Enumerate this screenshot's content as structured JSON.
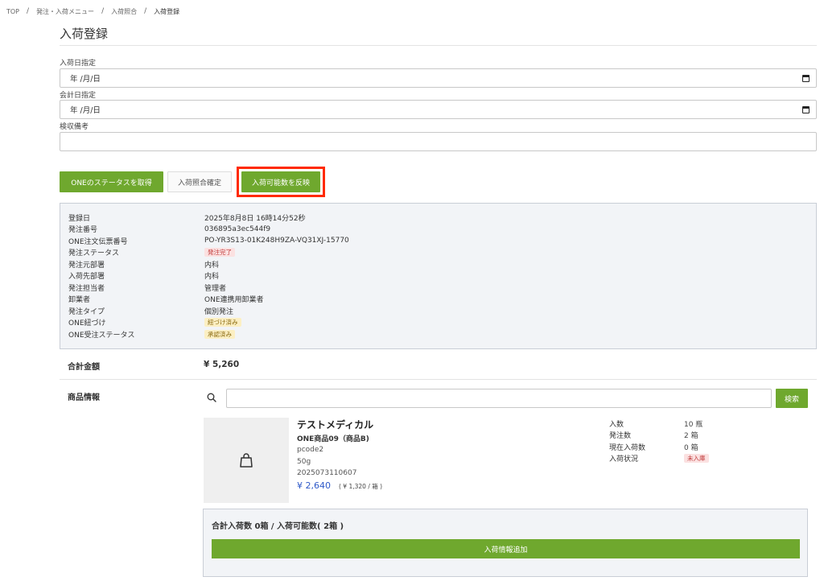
{
  "breadcrumb": {
    "items": [
      "TOP",
      "発注・入荷メニュー",
      "入荷照合"
    ],
    "current": "入荷登録",
    "separator": "/"
  },
  "page": {
    "title": "入荷登録"
  },
  "form": {
    "arrival_date_label": "入荷日指定",
    "arrival_date_value": "年 /月/日",
    "accounting_date_label": "会計日指定",
    "accounting_date_value": "年 /月/日",
    "inspection_note_label": "検収備考",
    "inspection_note_value": ""
  },
  "actions": {
    "get_status": "ONEのステータスを取得",
    "confirm_match": "入荷照合確定",
    "reflect_qty": "入荷可能数を反映"
  },
  "order_info": {
    "rows": [
      {
        "label": "登録日",
        "value": "2025年8月8日 16時14分52秒"
      },
      {
        "label": "発注番号",
        "value": "036895a3ec544f9"
      },
      {
        "label": "ONE注文伝票番号",
        "value": "PO-YR3S13-01K248H9ZA-VQ31XJ-15770"
      },
      {
        "label": "発注ステータス",
        "value": "発注完了",
        "badge": "red"
      },
      {
        "label": "発注元部署",
        "value": "内科"
      },
      {
        "label": "入荷先部署",
        "value": "内科"
      },
      {
        "label": "発注担当者",
        "value": "管理者"
      },
      {
        "label": "卸業者",
        "value": "ONE連携用卸業者"
      },
      {
        "label": "発注タイプ",
        "value": "個別発注"
      },
      {
        "label": "ONE紐づけ",
        "value": "紐づけ済み",
        "badge": "yellow"
      },
      {
        "label": "ONE受注ステータス",
        "value": "承認済み",
        "badge": "yellow"
      }
    ]
  },
  "total": {
    "label": "合計金額",
    "value": "¥ 5,260"
  },
  "products": {
    "label": "商品情報",
    "search_placeholder": "",
    "search_button": "検索",
    "item": {
      "maker": "テストメディカル",
      "name": "ONE商品09（商品B)",
      "code": "pcode2",
      "spec": "50g",
      "jan": "2025073110607",
      "price": "¥ 2,640",
      "unit_price": "( ¥ 1,320 / 箱 )",
      "icon": "shopping-bag-icon",
      "stats": [
        {
          "label": "入数",
          "value": "10 瓶"
        },
        {
          "label": "発注数",
          "value": "2 箱"
        },
        {
          "label": "現在入荷数",
          "value": "0 箱"
        },
        {
          "label": "入荷状況",
          "value": "未入庫",
          "badge": "red"
        }
      ]
    },
    "summary": {
      "title": "合計入荷数 0箱 / 入荷可能数( 2箱 )",
      "add_button": "入荷情報追加"
    }
  },
  "colors": {
    "accent_green": "#6fa82e",
    "highlight_red": "#ff2a00",
    "price_blue": "#2e59c8"
  }
}
